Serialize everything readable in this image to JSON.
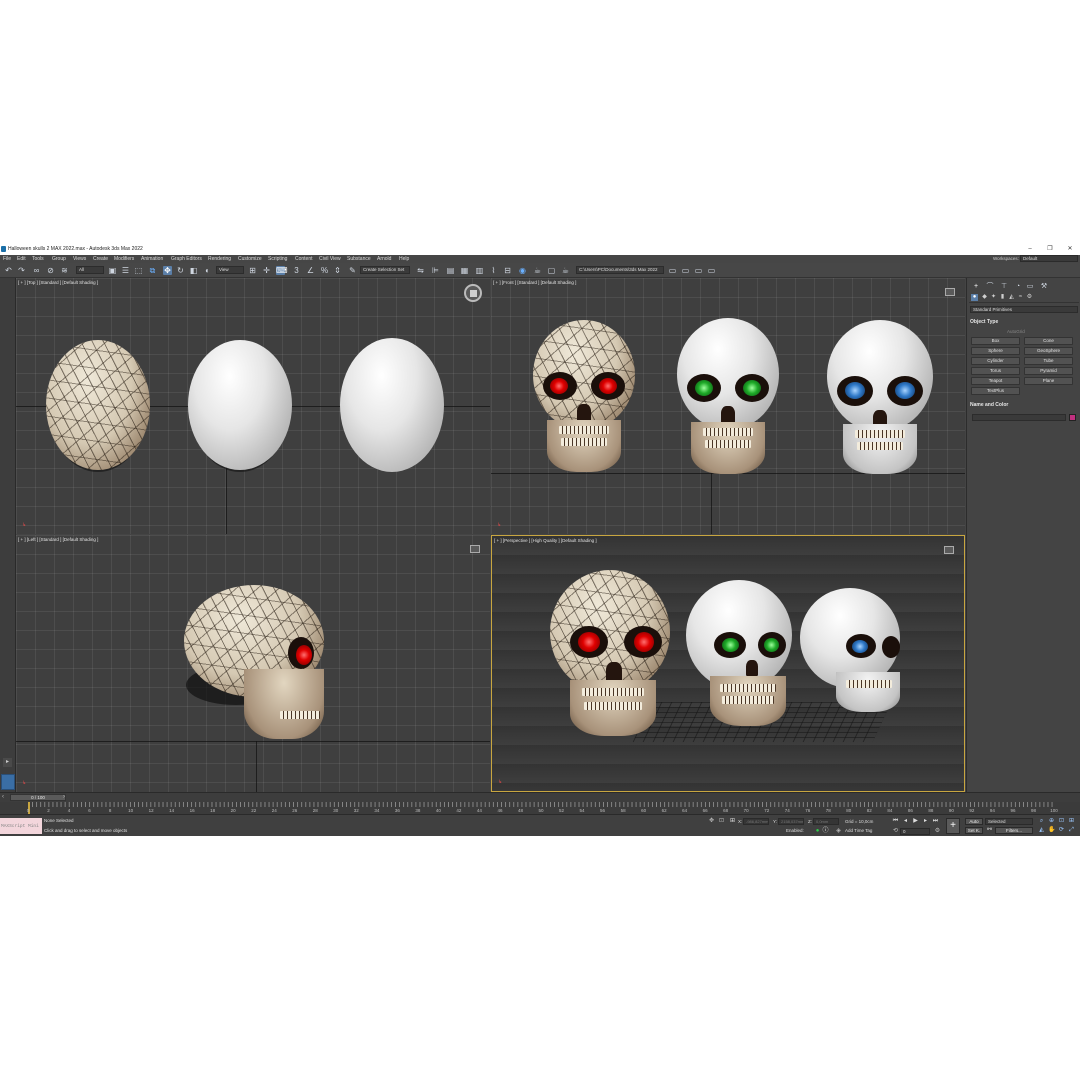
{
  "window": {
    "title": "Halloween skulls 2 MAX 2022.max - Autodesk 3ds Max 2022",
    "controls": [
      "–",
      "❐",
      "✕"
    ]
  },
  "menu": {
    "items": [
      "File",
      "Edit",
      "Tools",
      "Group",
      "Views",
      "Create",
      "Modifiers",
      "Animation",
      "Graph Editors",
      "Rendering",
      "Customize",
      "Scripting",
      "Content",
      "Civil View",
      "Substance",
      "Arnold",
      "Help"
    ],
    "workspace_label": "Workspaces:",
    "workspace_value": "Default"
  },
  "toolbar": {
    "selection_filter": "All",
    "ref_coord": "View",
    "named_selection_placeholder": "Create Selection Set",
    "project_path": "C:\\Users\\PC\\Documents\\3ds Max 2022",
    "icons": [
      "undo-icon",
      "redo-icon",
      "link-icon",
      "unlink-icon",
      "bind-spacewarp-icon",
      "select-object-icon",
      "select-by-name-icon",
      "rect-region-icon",
      "window-crossing-icon",
      "select-move-icon",
      "select-rotate-icon",
      "select-scale-icon",
      "placement-icon",
      "snaps-toggle-icon",
      "angle-snap-icon",
      "percent-snap-icon",
      "spinner-snap-icon",
      "mirror-icon",
      "align-icon",
      "scene-explorer-icon",
      "layer-explorer-icon",
      "ribbon-icon",
      "curve-editor-icon",
      "schematic-icon",
      "material-editor-icon",
      "render-setup-icon",
      "rendered-frame-icon",
      "render-icon"
    ]
  },
  "viewports": {
    "top": {
      "label": "[ + ] [Top ] [Standard ] [Default Shading ]"
    },
    "front": {
      "label": "[ + ] [Front ] [Standard ] [Default Shading ]"
    },
    "left": {
      "label": "[ + ] [Left ] [Standard ] [Default Shading ]"
    },
    "perspective": {
      "label": "[ + ] [Perspective ] [High Quality ] [Default Shading ]"
    }
  },
  "command_panel": {
    "tabs": [
      "create-tab-icon",
      "modify-tab-icon",
      "hierarchy-tab-icon",
      "motion-tab-icon",
      "display-tab-icon",
      "utilities-tab-icon"
    ],
    "category": "Standard Primitives",
    "object_type_header": "Object Type",
    "autogrid_label": "AutoGrid",
    "buttons": [
      "Box",
      "Cone",
      "Sphere",
      "GeoSphere",
      "Cylinder",
      "Tube",
      "Torus",
      "Pyramid",
      "Teapot",
      "Plane",
      "TextPlus"
    ],
    "name_color_header": "Name and Color",
    "swatch_color": "#c0307f"
  },
  "timeline": {
    "frame_display": "0 / 100",
    "ticks": [
      "0",
      "2",
      "4",
      "6",
      "8",
      "10",
      "12",
      "14",
      "16",
      "18",
      "20",
      "22",
      "24",
      "26",
      "28",
      "30",
      "32",
      "34",
      "36",
      "38",
      "40",
      "42",
      "44",
      "46",
      "48",
      "50",
      "52",
      "54",
      "56",
      "58",
      "60",
      "62",
      "64",
      "66",
      "68",
      "70",
      "72",
      "74",
      "76",
      "78",
      "80",
      "82",
      "84",
      "86",
      "88",
      "90",
      "92",
      "94",
      "96",
      "98",
      "100"
    ]
  },
  "status": {
    "maxscript": "MAXScript Mini",
    "selection": "None Selected",
    "prompt": "Click and drag to select and move objects",
    "x_label": "X:",
    "y_label": "Y:",
    "z_label": "Z:",
    "x_value": "-986,827mm",
    "y_value": "2158,037mm",
    "z_value": "0,0mm",
    "grid": "Grid = 10,0cm",
    "enabled": "Enabled:",
    "add_time_tag": "Add Time Tag",
    "auto": "Auto",
    "set_key": "Set K.",
    "key_filter_value": "Selected",
    "filters": "Filters...",
    "frame_spinner": "0"
  }
}
